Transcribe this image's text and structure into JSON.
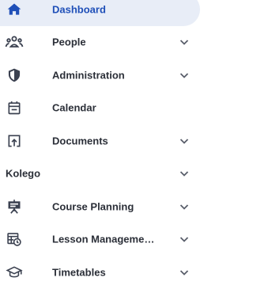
{
  "nav": {
    "items": [
      {
        "label": "Dashboard",
        "icon": "home-icon",
        "active": true,
        "expandable": false
      },
      {
        "label": "People",
        "icon": "people-icon",
        "active": false,
        "expandable": true
      },
      {
        "label": "Administration",
        "icon": "shield-icon",
        "active": false,
        "expandable": true
      },
      {
        "label": "Calendar",
        "icon": "calendar-icon",
        "active": false,
        "expandable": false
      },
      {
        "label": "Documents",
        "icon": "upload-box-icon",
        "active": false,
        "expandable": true
      }
    ],
    "section": {
      "label": "Kolego",
      "expandable": true
    },
    "section_items": [
      {
        "label": "Course Planning",
        "icon": "presentation-board-icon",
        "active": false,
        "expandable": true
      },
      {
        "label": "Lesson Manageme…",
        "icon": "schedule-table-icon",
        "active": false,
        "expandable": true
      },
      {
        "label": "Timetables",
        "icon": "graduation-cap-icon",
        "active": false,
        "expandable": true
      }
    ]
  },
  "colors": {
    "active_bg": "#e8edf7",
    "active_text": "#1f4fb8",
    "text": "#2b2f38",
    "icon": "#3b4150",
    "chevron": "#5a5f6b"
  }
}
